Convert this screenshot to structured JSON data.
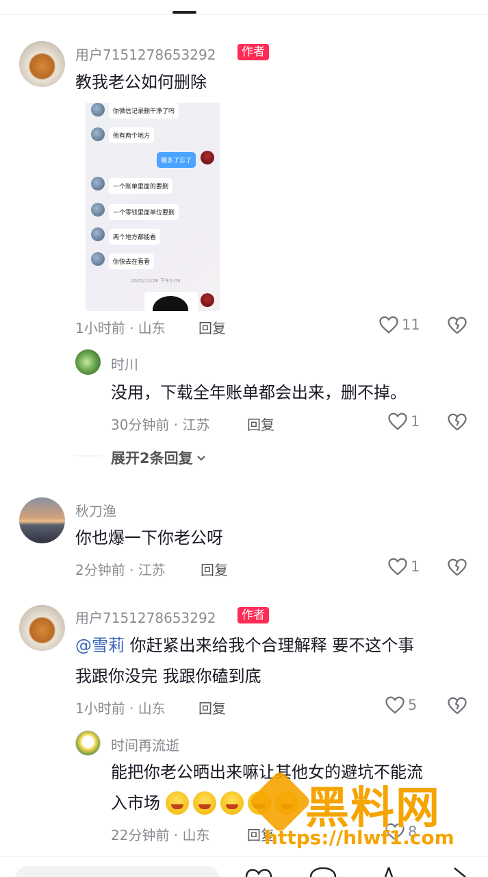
{
  "colors": {
    "badge": "#fe2c55",
    "text": "#161823",
    "muted": "#8a8b91",
    "mention": "#3a67b8",
    "watermark": "#f5a400"
  },
  "comments": [
    {
      "user": "用户7151278653292",
      "badge": "作者",
      "text": "教我老公如何删除",
      "meta": "1小时前 · 山东",
      "reply_label": "回复",
      "likes": "11",
      "image": {
        "messages": [
          {
            "from": "other",
            "text": "你微信记录删干净了吗"
          },
          {
            "from": "other",
            "text": "他有两个地方"
          },
          {
            "from": "me",
            "text": "哪多了忘了"
          },
          {
            "from": "other",
            "text": "一个账单里面的要删"
          },
          {
            "from": "other",
            "text": "一个零钱里面单位要删"
          },
          {
            "from": "other",
            "text": "两个地方都能看"
          },
          {
            "from": "other",
            "text": "你快去在看看"
          }
        ],
        "timestamp": "2025/11/28 下午2:09"
      },
      "replies": [
        {
          "user": "时川",
          "text": "没用，下载全年账单都会出来，删不掉。",
          "meta": "30分钟前 · 江苏",
          "reply_label": "回复",
          "likes": "1"
        }
      ],
      "expand_label": "展开2条回复"
    },
    {
      "user": "秋刀渔",
      "text": "你也爆一下你老公呀",
      "meta": "2分钟前 · 江苏",
      "reply_label": "回复",
      "likes": "1"
    },
    {
      "user": "用户7151278653292",
      "badge": "作者",
      "mention": "@雪莉",
      "text_line1": "你赶紧出来给我个合理解释 要不这个事",
      "text_line2": "我跟你没完 我跟你磕到底",
      "meta": "1小时前 · 山东",
      "reply_label": "回复",
      "likes": "5",
      "replies": [
        {
          "user": "时间再流逝",
          "text_line1": "能把你老公晒出来嘛让其他女的避坑不能流",
          "text_line2": "入市场",
          "meta": "22分钟前 · 山东",
          "reply_label": "回复",
          "likes": "8"
        }
      ]
    }
  ],
  "watermark": {
    "text": "黑料网",
    "url": "https://hlwf1.com"
  },
  "icons": [
    "heart-icon",
    "broken-heart-icon",
    "chevron-down-icon",
    "share-icon",
    "star-icon"
  ]
}
